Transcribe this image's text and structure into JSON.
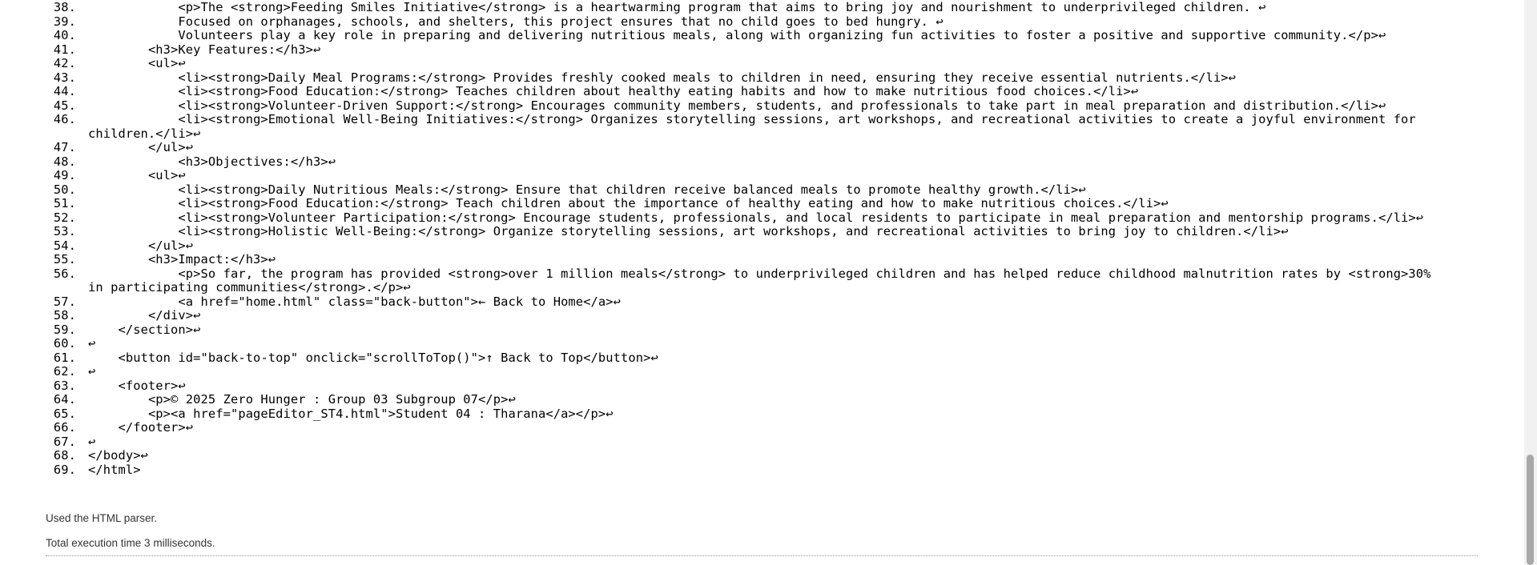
{
  "source_lines": [
    {
      "num": "38.",
      "text": "            <p>The <strong>Feeding Smiles Initiative</strong> is a heartwarming program that aims to bring joy and nourishment to underprivileged children. ↩"
    },
    {
      "num": "39.",
      "text": "            Focused on orphanages, schools, and shelters, this project ensures that no child goes to bed hungry. ↩"
    },
    {
      "num": "40.",
      "text": "            Volunteers play a key role in preparing and delivering nutritious meals, along with organizing fun activities to foster a positive and supportive community.</p>↩"
    },
    {
      "num": "41.",
      "text": "        <h3>Key Features:</h3>↩"
    },
    {
      "num": "42.",
      "text": "        <ul>↩"
    },
    {
      "num": "43.",
      "text": "            <li><strong>Daily Meal Programs:</strong> Provides freshly cooked meals to children in need, ensuring they receive essential nutrients.</li>↩"
    },
    {
      "num": "44.",
      "text": "            <li><strong>Food Education:</strong> Teaches children about healthy eating habits and how to make nutritious food choices.</li>↩"
    },
    {
      "num": "45.",
      "text": "            <li><strong>Volunteer-Driven Support:</strong> Encourages community members, students, and professionals to take part in meal preparation and distribution.</li>↩"
    },
    {
      "num": "46.",
      "text": "            <li><strong>Emotional Well-Being Initiatives:</strong> Organizes storytelling sessions, art workshops, and recreational activities to create a joyful environment for children.</li>↩"
    },
    {
      "num": "47.",
      "text": "        </ul>↩"
    },
    {
      "num": "48.",
      "text": "            <h3>Objectives:</h3>↩"
    },
    {
      "num": "49.",
      "text": "        <ul>↩"
    },
    {
      "num": "50.",
      "text": "            <li><strong>Daily Nutritious Meals:</strong> Ensure that children receive balanced meals to promote healthy growth.</li>↩"
    },
    {
      "num": "51.",
      "text": "            <li><strong>Food Education:</strong> Teach children about the importance of healthy eating and how to make nutritious choices.</li>↩"
    },
    {
      "num": "52.",
      "text": "            <li><strong>Volunteer Participation:</strong> Encourage students, professionals, and local residents to participate in meal preparation and mentorship programs.</li>↩"
    },
    {
      "num": "53.",
      "text": "            <li><strong>Holistic Well-Being:</strong> Organize storytelling sessions, art workshops, and recreational activities to bring joy to children.</li>↩"
    },
    {
      "num": "54.",
      "text": "        </ul>↩"
    },
    {
      "num": "55.",
      "text": "        <h3>Impact:</h3>↩"
    },
    {
      "num": "56.",
      "text": "            <p>So far, the program has provided <strong>over 1 million meals</strong> to underprivileged children and has helped reduce childhood malnutrition rates by <strong>30% in participating communities</strong>.</p>↩"
    },
    {
      "num": "57.",
      "text": "            <a href=\"home.html\" class=\"back-button\">← Back to Home</a>↩"
    },
    {
      "num": "58.",
      "text": "        </div>↩"
    },
    {
      "num": "59.",
      "text": "    </section>↩"
    },
    {
      "num": "60.",
      "text": "↩"
    },
    {
      "num": "61.",
      "text": "    <button id=\"back-to-top\" onclick=\"scrollToTop()\">↑ Back to Top</button>↩"
    },
    {
      "num": "62.",
      "text": "↩"
    },
    {
      "num": "63.",
      "text": "    <footer>↩"
    },
    {
      "num": "64.",
      "text": "        <p>© 2025 Zero Hunger : Group 03 Subgroup 07</p>↩"
    },
    {
      "num": "65.",
      "text": "        <p><a href=\"pageEditor_ST4.html\">Student 04 : Tharana</a></p>↩"
    },
    {
      "num": "66.",
      "text": "    </footer>↩"
    },
    {
      "num": "67.",
      "text": "↩"
    },
    {
      "num": "68.",
      "text": "</body>↩"
    },
    {
      "num": "69.",
      "text": "</html>"
    }
  ],
  "notes": {
    "parser": "Used the HTML parser.",
    "execution_time": "Total execution time 3 milliseconds."
  }
}
